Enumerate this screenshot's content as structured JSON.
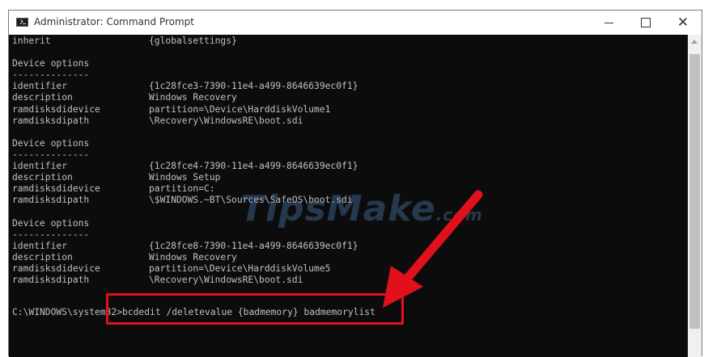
{
  "window": {
    "title": "Administrator: Command Prompt",
    "minimize_glyph": "—",
    "maximize_glyph": "☐",
    "close_glyph": "✕"
  },
  "console": {
    "lines": [
      {
        "k": "inherit",
        "v": "{globalsettings}"
      },
      {
        "k": "",
        "v": ""
      },
      {
        "k": "Device options",
        "v": ""
      },
      {
        "k": "--------------",
        "v": ""
      },
      {
        "k": "identifier",
        "v": "{1c28fce3-7390-11e4-a499-8646639ec0f1}"
      },
      {
        "k": "description",
        "v": "Windows Recovery"
      },
      {
        "k": "ramdisksdidevice",
        "v": "partition=\\Device\\HarddiskVolume1"
      },
      {
        "k": "ramdisksdipath",
        "v": "\\Recovery\\WindowsRE\\boot.sdi"
      },
      {
        "k": "",
        "v": ""
      },
      {
        "k": "Device options",
        "v": ""
      },
      {
        "k": "--------------",
        "v": ""
      },
      {
        "k": "identifier",
        "v": "{1c28fce4-7390-11e4-a499-8646639ec0f1}"
      },
      {
        "k": "description",
        "v": "Windows Setup"
      },
      {
        "k": "ramdisksdidevice",
        "v": "partition=C:"
      },
      {
        "k": "ramdisksdipath",
        "v": "\\$WINDOWS.~BT\\Sources\\SafeOS\\boot.sdi"
      },
      {
        "k": "",
        "v": ""
      },
      {
        "k": "Device options",
        "v": ""
      },
      {
        "k": "--------------",
        "v": ""
      },
      {
        "k": "identifier",
        "v": "{1c28fce8-7390-11e4-a499-8646639ec0f1}"
      },
      {
        "k": "description",
        "v": "Windows Recovery"
      },
      {
        "k": "ramdisksdidevice",
        "v": "partition=\\Device\\HarddiskVolume5"
      },
      {
        "k": "ramdisksdipath",
        "v": "\\Recovery\\WindowsRE\\boot.sdi"
      }
    ],
    "prompt": "C:\\WINDOWS\\system32>",
    "command": "bcdedit /deletevalue {badmemory} badmemorylist"
  },
  "watermark": {
    "text": "TipsMake",
    "suffix": ".com"
  },
  "colors": {
    "console_bg": "#0c0c0c",
    "console_text": "#c0c0c0",
    "highlight": "#e0101c"
  }
}
